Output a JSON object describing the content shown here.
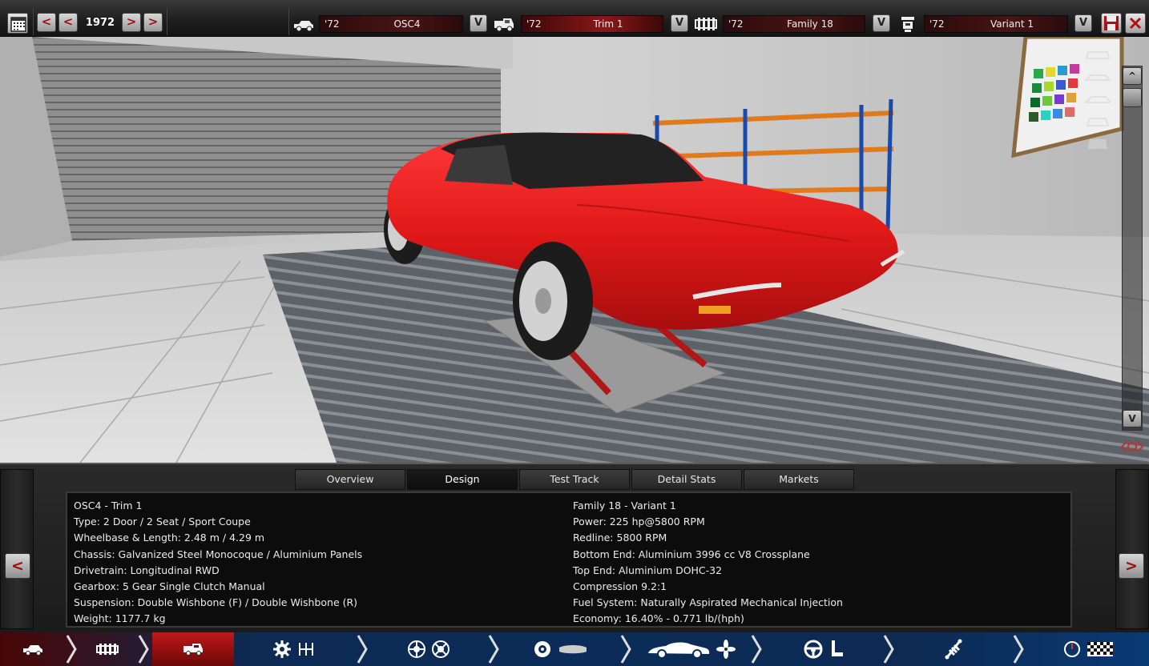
{
  "topbar": {
    "year": "1972",
    "model": {
      "year": "'72",
      "name": "OSC4"
    },
    "trim": {
      "year": "'72",
      "name": "Trim 1"
    },
    "family": {
      "year": "'72",
      "name": "Family 18"
    },
    "variant": {
      "year": "'72",
      "name": "Variant 1"
    },
    "prev_label": "<",
    "next_label": ">",
    "dropdown_label": "V"
  },
  "viewport": {
    "scroll_up": "^",
    "scroll_down": "V"
  },
  "tabs": [
    "Overview",
    "Design",
    "Test Track",
    "Detail Stats",
    "Markets"
  ],
  "active_tab": "Design",
  "panel": {
    "prev_label": "<",
    "next_label": ">",
    "left": [
      "OSC4 - Trim 1",
      "Type: 2 Door / 2 Seat / Sport Coupe",
      "Wheelbase & Length: 2.48 m / 4.29 m",
      "Chassis: Galvanized Steel Monocoque / Aluminium Panels",
      "Drivetrain: Longitudinal RWD",
      "Gearbox: 5 Gear Single Clutch Manual",
      "Suspension: Double Wishbone (F) / Double Wishbone (R)",
      "Weight: 1177.7 kg"
    ],
    "right": [
      "Family 18 - Variant 1",
      "Power: 225 hp@5800 RPM",
      "Redline: 5800 RPM",
      "Bottom End: Aluminium 3996 cc V8 Crossplane",
      "Top End: Aluminium DOHC-32",
      "Compression 9.2:1",
      "Fuel System: Naturally Aspirated Mechanical Injection",
      "Economy: 16.40% - 0.771 lb/(hph)"
    ]
  },
  "stages": [
    {
      "id": "model",
      "icons": [
        "car-model-icon"
      ]
    },
    {
      "id": "chassis",
      "icons": [
        "chassis-icon"
      ]
    },
    {
      "id": "trim",
      "icons": [
        "car-trim-icon"
      ],
      "active": true
    },
    {
      "id": "drivetrain",
      "icons": [
        "gear-icon",
        "gearbox-icon"
      ]
    },
    {
      "id": "suspension",
      "icons": [
        "wheel-icon",
        "brake-icon"
      ]
    },
    {
      "id": "wheels",
      "icons": [
        "tire-icon",
        "bumper-icon"
      ]
    },
    {
      "id": "body",
      "icons": [
        "car-body-icon",
        "fan-icon"
      ]
    },
    {
      "id": "interior",
      "icons": [
        "steering-wheel-icon",
        "seat-icon"
      ]
    },
    {
      "id": "fixtures",
      "icons": [
        "shock-absorber-icon"
      ]
    },
    {
      "id": "testing",
      "icons": [
        "gauge-icon",
        "checkered-flag-icon"
      ]
    }
  ],
  "colors": {
    "car_red": "#e01818",
    "accent_red": "#9a1010",
    "stage_blue": "#0b2c58"
  }
}
